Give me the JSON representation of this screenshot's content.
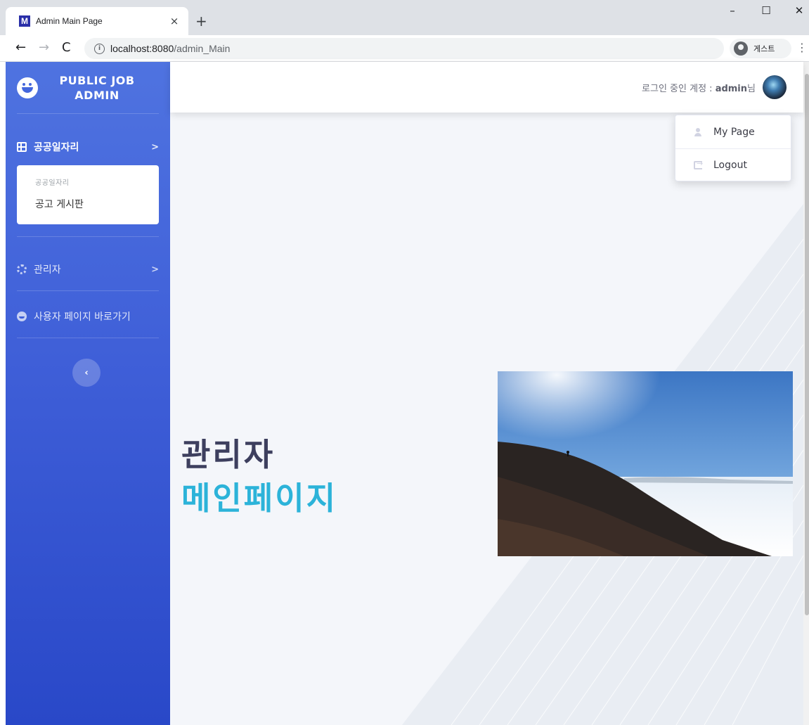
{
  "browser": {
    "tab_title": "Admin Main Page",
    "favicon_letter": "M",
    "tab_close": "×",
    "new_tab": "+",
    "url_host": "localhost:8080",
    "url_path": "/admin_Main",
    "profile_label": "게스트",
    "window_controls": {
      "minimize": "–",
      "maximize": "☐",
      "close": "✕"
    },
    "nav": {
      "back": "←",
      "forward": "→",
      "reload": "C",
      "menu": "⋮",
      "info": "i"
    }
  },
  "sidebar": {
    "brand_line1": "PUBLIC JOB",
    "brand_line2": "ADMIN",
    "public_jobs": {
      "label": "공공일자리",
      "icon": "table-icon",
      "chevron": ">",
      "submenu_header": "공공일자리",
      "submenu_item": "공고 게시판"
    },
    "admin": {
      "label": "관리자",
      "icon": "gear-icon",
      "chevron": ">"
    },
    "user_page": {
      "label": "사용자 페이지 바로가기",
      "icon": "smile-icon"
    },
    "toggle": "‹"
  },
  "topbar": {
    "login_prefix": "로그인 중인 계정 : ",
    "username": "admin",
    "suffix": "님"
  },
  "dropdown": {
    "my_page": "My Page",
    "logout": "Logout"
  },
  "main": {
    "heading_line1": "관리자",
    "heading_line2": "메인페이지"
  },
  "colors": {
    "sidebar_top": "#4f73e0",
    "sidebar_bottom": "#2948c8",
    "heading_dark": "#3d3f5e",
    "heading_accent": "#2cb3d9"
  }
}
